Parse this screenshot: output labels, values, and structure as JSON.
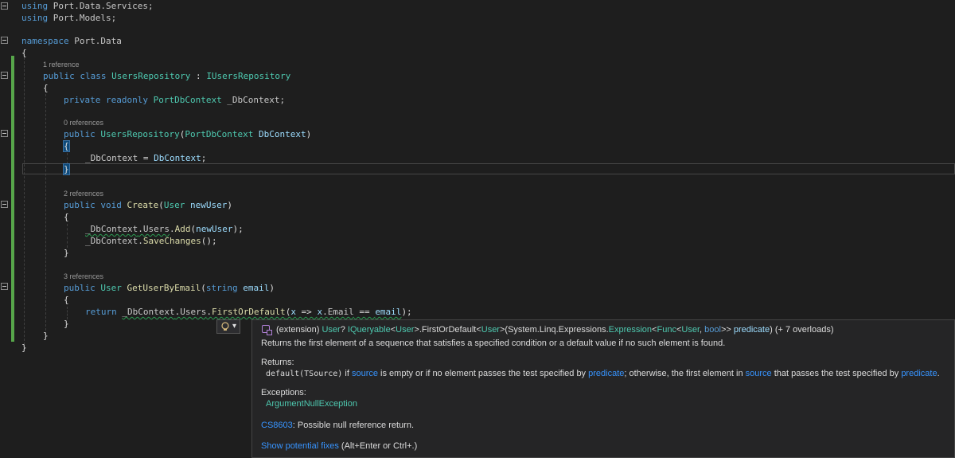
{
  "code": {
    "using1": {
      "kw": "using",
      "ns": " Port.Data.Services;"
    },
    "using2": {
      "kw": "using",
      "ns": " Port.Models;"
    },
    "namespace": {
      "kw": "namespace",
      "ns": " Port.Data"
    },
    "brace_open": "{",
    "brace_close": "}",
    "class_lens": "1 reference",
    "class_decl": {
      "kw": "public class ",
      "name": "UsersRepository",
      "sep": " : ",
      "iface": "IUsersRepository"
    },
    "field": {
      "kw": "private readonly ",
      "type": "PortDbContext",
      "name": " _DbContext;"
    },
    "ctor_lens": "0 references",
    "ctor_decl": {
      "kw": "public ",
      "name": "UsersRepository",
      "open": "(",
      "ptype": "PortDbContext",
      "pname": " DbContext",
      "close": ")"
    },
    "ctor_body": {
      "field": "_DbContext",
      "op": " = ",
      "param": "DbContext",
      "end": ";"
    },
    "create_lens": "2 references",
    "create_decl": {
      "kw": "public void ",
      "name": "Create",
      "open": "(",
      "ptype": "User",
      "pname": " newUser",
      "close": ")"
    },
    "create_body1": {
      "a": "_DbContext",
      "b": ".",
      "c": "Users",
      "d": ".",
      "e": "Add",
      "f": "(",
      "g": "newUser",
      "h": ");"
    },
    "create_body2": {
      "a": "_DbContext",
      "b": ".",
      "e": "SaveChanges",
      "f": "();"
    },
    "get_lens": "3 references",
    "get_decl": {
      "kw": "public ",
      "type": "User",
      "name": " GetUserByEmail",
      "open": "(",
      "pkw": "string",
      "pname": " email",
      "close": ")"
    },
    "get_body": {
      "kw": "return ",
      "a": "_DbContext",
      "b": ".",
      "c": "Users",
      "d": ".",
      "e": "FirstOrDefault",
      "f": "(",
      "x": "x",
      "arrow": " => ",
      "x2": "x",
      "dot": ".",
      "prop": "Email",
      "eq": " == ",
      "p": "email",
      "end": ");"
    }
  },
  "quickinfo": {
    "sig": {
      "pre": "(extension) ",
      "t1": "User",
      "q": "? ",
      "t2": "IQueryable",
      "lt1": "<",
      "t3": "User",
      "gt1": ">.FirstOrDefault<",
      "t4": "User",
      "gt2": ">(System.Linq.Expressions.",
      "t5": "Expression",
      "lt2": "<",
      "t6": "Func",
      "lt3": "<",
      "t7": "User",
      "comma": ", ",
      "k1": "bool",
      "gt3": ">> ",
      "p1": "predicate",
      "tail": ") (+ 7 overloads)"
    },
    "summary": "Returns the first element of a sequence that satisfies a specified condition or a default value if no such element is found.",
    "returns_label": "Returns:",
    "returns": {
      "code": "default(TSource)",
      "a": " if ",
      "l1": "source",
      "b": " is empty or if no element passes the test specified by ",
      "l2": "predicate",
      "c": "; otherwise, the first element in ",
      "l3": "source",
      "d": " that passes the test specified by ",
      "l4": "predicate",
      "e": "."
    },
    "exceptions_label": "Exceptions:",
    "exception": "ArgumentNullException",
    "warning_code": "CS8603",
    "warning_text": ": Possible null reference return.",
    "fix_link": "Show potential fixes",
    "fix_keys": " (Alt+Enter or Ctrl+.)"
  },
  "lightbulb": {
    "icon": "lightbulb-icon",
    "dropdown": "▾"
  },
  "colors": {
    "background": "#1e1e1e",
    "keyword": "#569cd6",
    "type": "#4ec9b0",
    "method": "#dcdcaa",
    "param": "#9cdcfe",
    "change_bar": "#57a64a",
    "link": "#3794ff"
  }
}
